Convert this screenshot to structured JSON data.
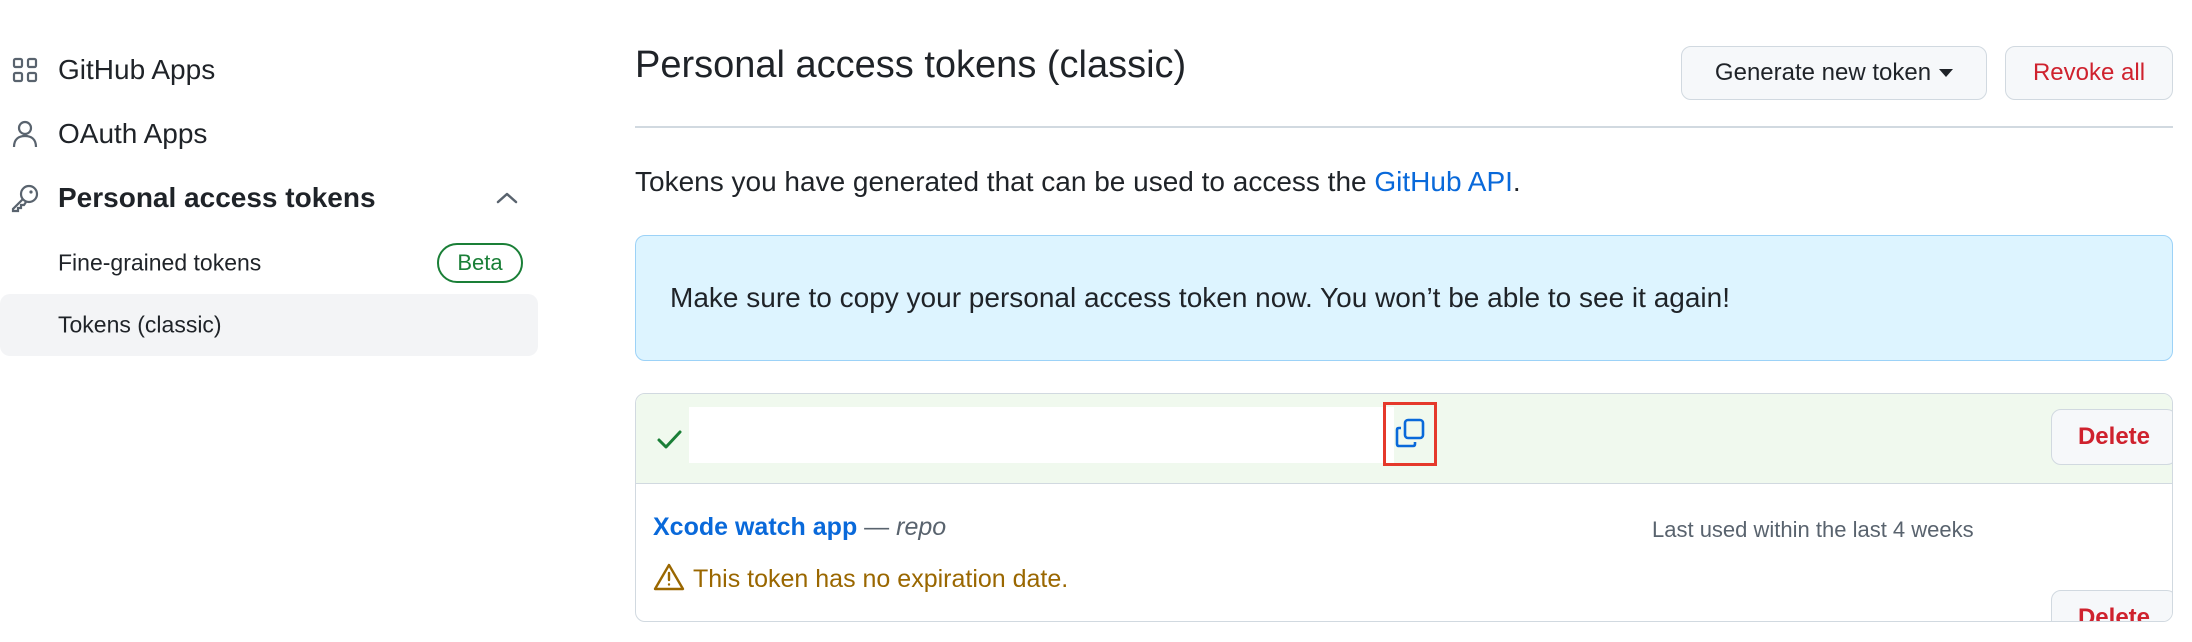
{
  "sidebar": {
    "github_apps": "GitHub Apps",
    "oauth_apps": "OAuth Apps",
    "personal_access_tokens": "Personal access tokens",
    "fine_grained": "Fine-grained tokens",
    "beta_badge": "Beta",
    "tokens_classic": "Tokens (classic)",
    "icons": {
      "github_apps": "apps-grid-icon",
      "oauth_apps": "person-icon",
      "personal_access_tokens": "key-icon",
      "collapse": "chevron-up-icon"
    }
  },
  "header": {
    "title": "Personal access tokens (classic)",
    "generate_label": "Generate new token",
    "revoke_label": "Revoke all"
  },
  "intro": {
    "text_before": "Tokens you have generated that can be used to access the ",
    "link_text": "GitHub API",
    "text_after": "."
  },
  "flash": {
    "message": "Make sure to copy your personal access token now. You won’t be able to see it again!"
  },
  "tokens": {
    "new_token": {
      "value": "",
      "delete_label": "Delete",
      "icons": [
        "check-icon",
        "copy-icon"
      ]
    },
    "existing": {
      "name": "Xcode watch app",
      "separator": " — ",
      "scope": "repo",
      "last_used": "Last used within the last 4 weeks",
      "delete_label": "Delete",
      "warning": "This token has no expiration date.",
      "warning_icon": "alert-triangle-icon"
    }
  },
  "colors": {
    "link": "#0969da",
    "danger": "#cf222e",
    "success": "#1a7f37",
    "warning": "#9a6700",
    "flash_bg": "#ddf4ff",
    "new_token_bg": "#f0f9ee",
    "highlight_border": "#e5392b"
  }
}
